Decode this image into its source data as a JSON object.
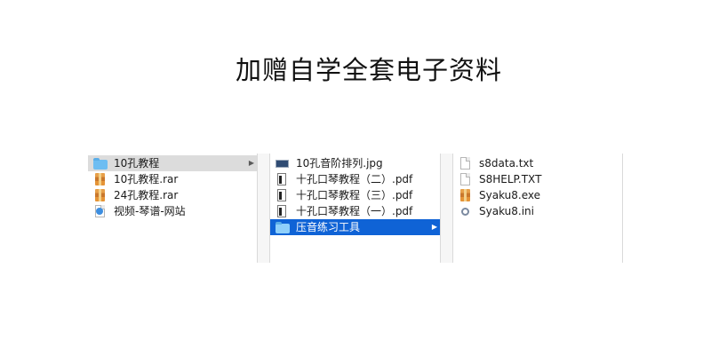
{
  "headline": "加赠自学全套电子资料",
  "column1": {
    "items": [
      {
        "label": "10孔教程",
        "icon": "folder-icon"
      },
      {
        "label": "10孔教程.rar",
        "icon": "rar-archive-icon"
      },
      {
        "label": "24孔教程.rar",
        "icon": "rar-archive-icon"
      },
      {
        "label": "视频-琴谱-网站",
        "icon": "web-document-icon"
      }
    ]
  },
  "column2": {
    "items": [
      {
        "label": "10孔音阶排列.jpg",
        "icon": "image-file-icon"
      },
      {
        "label": "十孔口琴教程（二）.pdf",
        "icon": "pdf-file-icon"
      },
      {
        "label": "十孔口琴教程（三）.pdf",
        "icon": "pdf-file-icon"
      },
      {
        "label": "十孔口琴教程（一）.pdf",
        "icon": "pdf-file-icon"
      },
      {
        "label": "压音练习工具",
        "icon": "folder-icon"
      }
    ]
  },
  "column3": {
    "items": [
      {
        "label": "s8data.txt",
        "icon": "text-file-icon"
      },
      {
        "label": "S8HELP.TXT",
        "icon": "text-file-icon"
      },
      {
        "label": "Syaku8.exe",
        "icon": "exe-file-icon"
      },
      {
        "label": "Syaku8.ini",
        "icon": "settings-file-icon"
      }
    ]
  },
  "colors": {
    "selected_active": "#0f63d6",
    "selected_inactive": "#dcdcdc",
    "folder": "#6dbdf2"
  }
}
